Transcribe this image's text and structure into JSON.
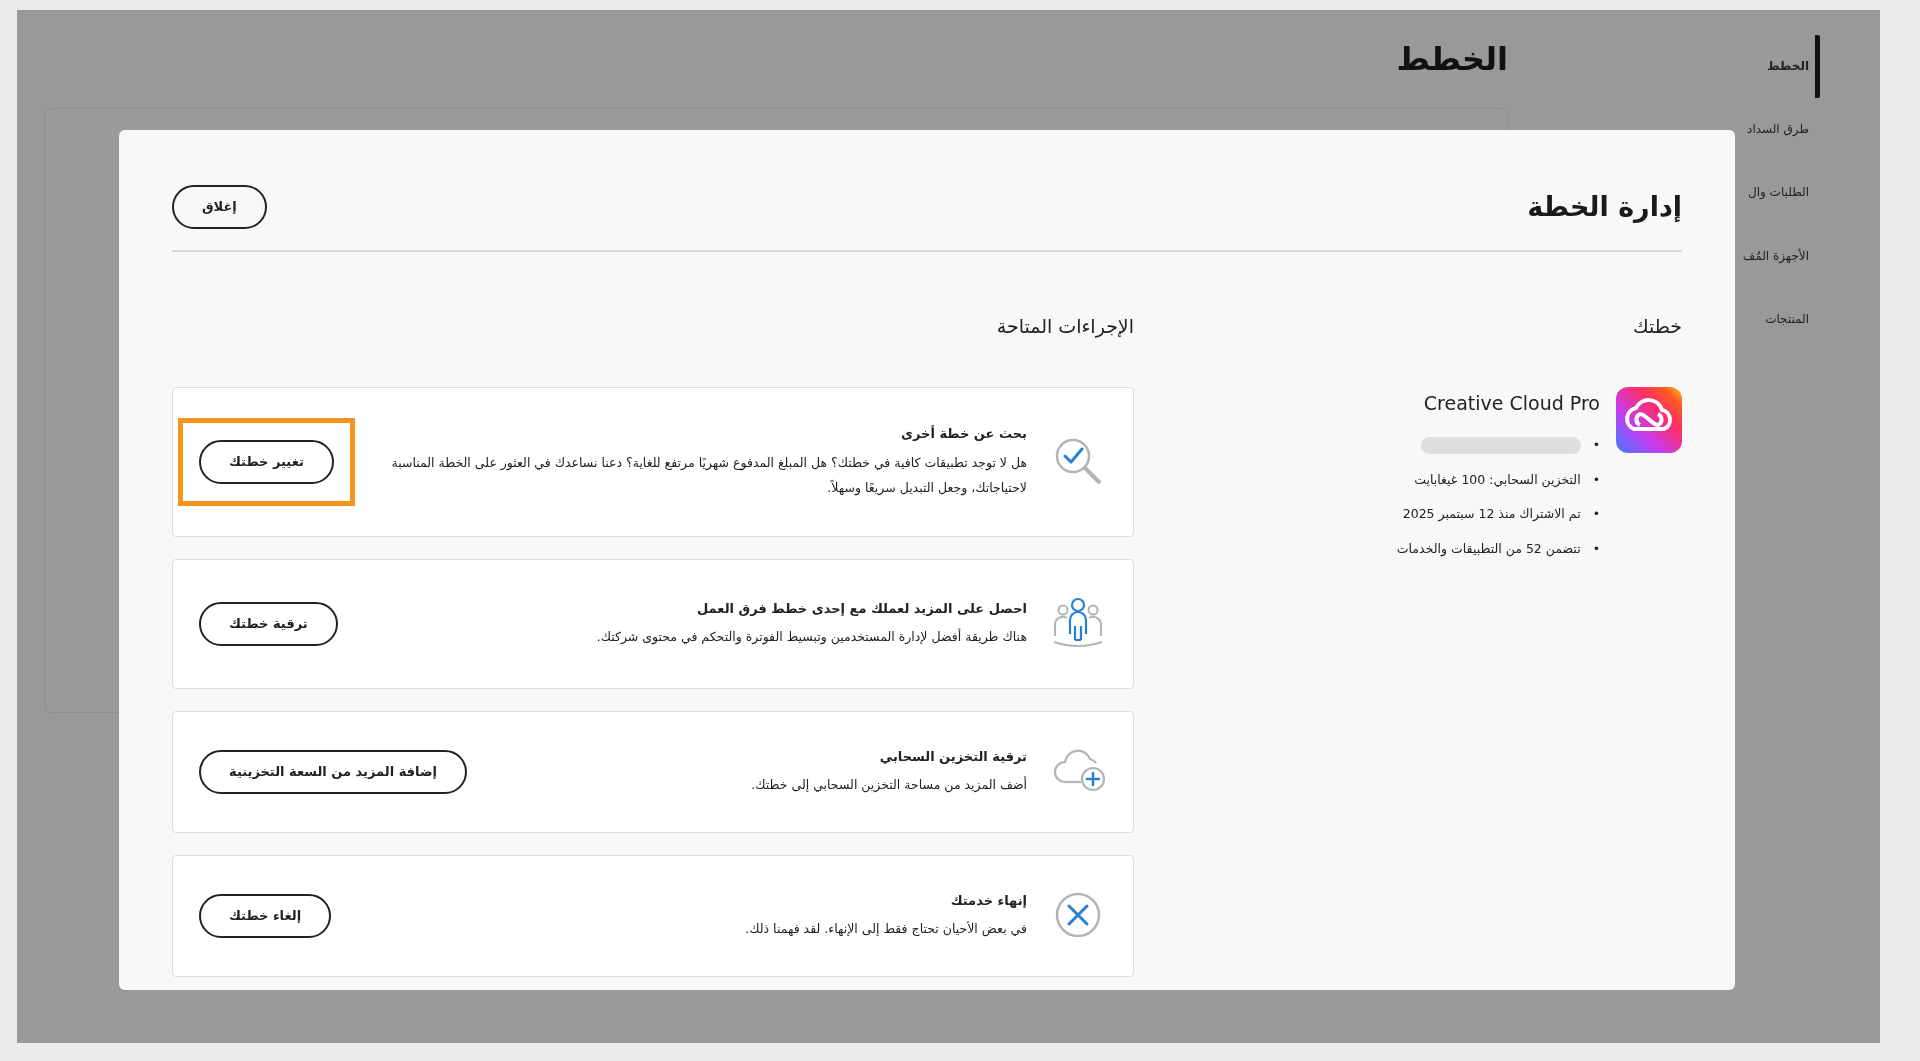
{
  "page": {
    "title": "الخطط"
  },
  "sidebar": {
    "items": [
      {
        "label": "الخطط",
        "selected": true
      },
      {
        "label": "طرق السداد",
        "selected": false
      },
      {
        "label": "الطلبات وال",
        "selected": false
      },
      {
        "label": "الأجهزة المُف",
        "selected": false
      },
      {
        "label": "المنتجات",
        "selected": false
      }
    ]
  },
  "modal": {
    "title": "إدارة الخطة",
    "close_button": "إغلاق",
    "plan": {
      "heading": "خطتك",
      "name": "Creative Cloud Pro",
      "details": [
        {
          "kind": "redacted",
          "bullet": "•"
        },
        {
          "kind": "text",
          "bullet": "•",
          "text": "التخزين السحابي: 100 غيغابايت"
        },
        {
          "kind": "text",
          "bullet": "•",
          "text": "تم الاشتراك منذ 12 سبتمبر 2025"
        },
        {
          "kind": "text",
          "bullet": "•",
          "text": "تتضمن 52 من التطبيقات والخدمات"
        }
      ]
    },
    "actions": {
      "heading": "الإجراءات المتاحة",
      "items": [
        {
          "kind": "search",
          "title": "بحث عن خطة أخرى",
          "description": "هل لا توجد تطبيقات كافية في خطتك؟ هل المبلغ المدفوع شهريًا مرتفع للغاية؟ دعنا نساعدك في العثور على الخطة المناسبة لاحتياجاتك، وجعل التبديل سريعًا وسهلاً.",
          "button": "تغيير خطتك",
          "highlighted": true
        },
        {
          "kind": "team",
          "title": "احصل على المزيد لعملك مع إحدى خطط فرق العمل",
          "description": "هناك طريقة أفضل لإدارة المستخدمين وتبسيط الفوترة والتحكم في محتوى شركتك.",
          "button": "ترقية خطتك",
          "highlighted": false
        },
        {
          "kind": "storage",
          "title": "ترقية التخزين السحابي",
          "description": "أضف المزيد من مساحة التخزين السحابي إلى خطتك.",
          "button": "إضافة المزيد من السعة التخزينية",
          "highlighted": false
        },
        {
          "kind": "cancel",
          "title": "إنهاء خدمتك",
          "description": "في بعض الأحيان تحتاج فقط إلى الإنهاء. لقد فهمنا ذلك.",
          "button": "إلغاء خطتك",
          "highlighted": false
        }
      ]
    }
  }
}
